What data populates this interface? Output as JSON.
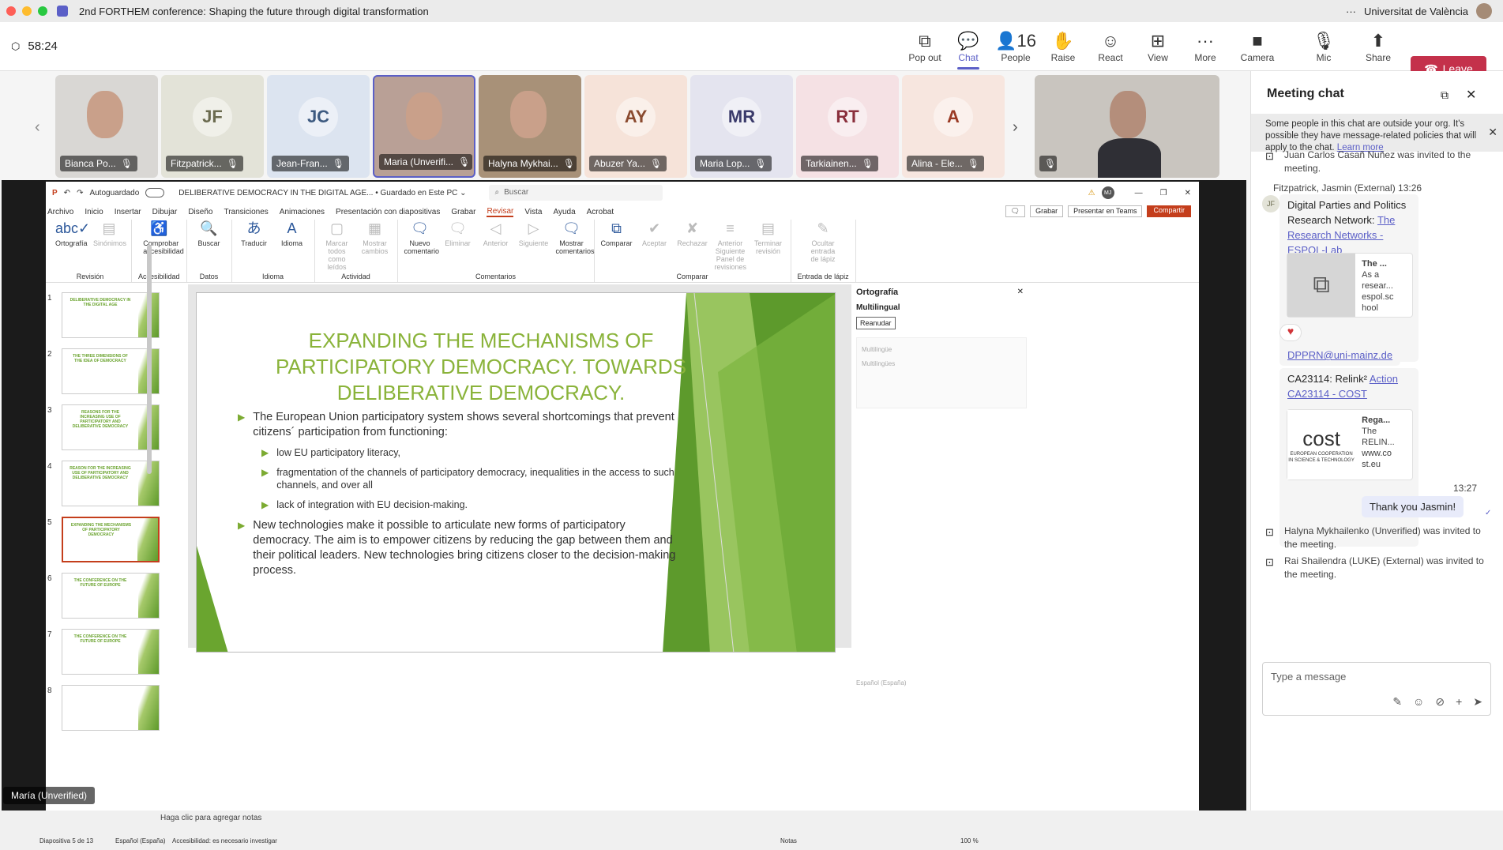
{
  "window": {
    "title": "2nd FORTHEM conference: Shaping the future through digital transformation",
    "org": "Universitat de València",
    "more": "···"
  },
  "meeting": {
    "timer": "58:24",
    "buttons": [
      {
        "label": "Pop out",
        "icon": "popout-icon",
        "glyph": "⧉"
      },
      {
        "label": "Chat",
        "icon": "chat-icon",
        "glyph": "💬"
      },
      {
        "label": "People",
        "icon": "people-icon",
        "glyph": "👤16"
      },
      {
        "label": "Raise",
        "icon": "hand-icon",
        "glyph": "✋"
      },
      {
        "label": "React",
        "icon": "smile-icon",
        "glyph": "☺"
      },
      {
        "label": "View",
        "icon": "grid-icon",
        "glyph": "⊞"
      },
      {
        "label": "More",
        "icon": "more-icon",
        "glyph": "···"
      },
      {
        "label": "Camera",
        "icon": "camera-icon",
        "glyph": "■"
      },
      {
        "label": "Mic",
        "icon": "mic-off-icon",
        "glyph": "🎙"
      },
      {
        "label": "Share",
        "icon": "share-icon",
        "glyph": "⬆"
      }
    ],
    "leave": "Leave"
  },
  "participants": [
    {
      "name": "Bianca Po...",
      "initials": "",
      "bg": "#d9d7d4",
      "photo": true
    },
    {
      "name": "Fitzpatrick...",
      "initials": "JF",
      "bg": "#e3e3d8",
      "fg": "#6b6b4f"
    },
    {
      "name": "Jean-Fran...",
      "initials": "JC",
      "bg": "#dce4f0",
      "fg": "#3d5a80"
    },
    {
      "name": "Maria (Unverifi...",
      "initials": "",
      "bg": "#b9a096",
      "photo": true
    },
    {
      "name": "Halyna Mykhai...",
      "initials": "",
      "bg": "#a89178",
      "photo": true
    },
    {
      "name": "Abuzer Ya...",
      "initials": "AY",
      "bg": "#f6e3d9",
      "fg": "#8a4a2f"
    },
    {
      "name": "Maria Lop...",
      "initials": "MR",
      "bg": "#e4e4ef",
      "fg": "#3b3b6b"
    },
    {
      "name": "Tarkiainen...",
      "initials": "RT",
      "bg": "#f5e1e4",
      "fg": "#8a2f3c"
    },
    {
      "name": "Alina - Ele...",
      "initials": "A",
      "bg": "#f7e6df",
      "fg": "#9a3a24"
    }
  ],
  "presenter": "María (Unverified)",
  "ppt": {
    "autosave": "Autoguardado",
    "doc": "DELIBERATIVE DEMOCRACY IN THE DIGITAL AGE... • Guardado en Este PC ⌄",
    "search": "Buscar",
    "user": "MJ",
    "menu": [
      "Archivo",
      "Inicio",
      "Insertar",
      "Dibujar",
      "Diseño",
      "Transiciones",
      "Animaciones",
      "Presentación con diapositivas",
      "Grabar",
      "Revisar",
      "Vista",
      "Ayuda",
      "Acrobat"
    ],
    "record": "Grabar",
    "present_teams": "Presentar en Teams",
    "share": "Compartir",
    "groups": [
      {
        "label": "Revisión",
        "items": [
          {
            "t": "Ortografía",
            "g": "abc✓",
            "d": false
          },
          {
            "t": "Sinónimos",
            "g": "▤",
            "d": true
          }
        ]
      },
      {
        "label": "Accesibilidad",
        "items": [
          {
            "t": "Comprobar accesibilidad",
            "g": "♿",
            "d": false
          }
        ]
      },
      {
        "label": "Datos",
        "items": [
          {
            "t": "Buscar",
            "g": "🔍",
            "d": false
          }
        ]
      },
      {
        "label": "Idioma",
        "items": [
          {
            "t": "Traducir",
            "g": "あ",
            "d": false
          },
          {
            "t": "Idioma",
            "g": "A",
            "d": false
          }
        ]
      },
      {
        "label": "Actividad",
        "items": [
          {
            "t": "Marcar todos como leídos",
            "g": "▢",
            "d": true
          },
          {
            "t": "Mostrar cambios",
            "g": "▦",
            "d": true
          }
        ]
      },
      {
        "label": "Comentarios",
        "items": [
          {
            "t": "Nuevo comentario",
            "g": "🗨",
            "d": false
          },
          {
            "t": "Eliminar",
            "g": "🗨",
            "d": true
          },
          {
            "t": "Anterior",
            "g": "◁",
            "d": true
          },
          {
            "t": "Siguiente",
            "g": "▷",
            "d": true
          },
          {
            "t": "Mostrar comentarios",
            "g": "🗨",
            "d": false
          }
        ]
      },
      {
        "label": "Comparar",
        "items": [
          {
            "t": "Comparar",
            "g": "⧉",
            "d": false
          },
          {
            "t": "Aceptar",
            "g": "✔",
            "d": true
          },
          {
            "t": "Rechazar",
            "g": "✘",
            "d": true
          },
          {
            "t": "Anterior Siguiente Panel de revisiones",
            "g": "≡",
            "d": true
          },
          {
            "t": "Terminar revisión",
            "g": "▤",
            "d": true
          }
        ]
      },
      {
        "label": "Entrada de lápiz",
        "items": [
          {
            "t": "Ocultar entrada de lápiz",
            "g": "✎",
            "d": true
          }
        ]
      }
    ],
    "thumbs": [
      {
        "n": "1",
        "t": "DELIBERATIVE DEMOCRACY IN THE DIGITAL AGE"
      },
      {
        "n": "2",
        "t": "THE THREE DIMENSIONS OF THE IDEA OF DEMOCRACY"
      },
      {
        "n": "3",
        "t": "REASONS FOR THE INCREASING USE OF PARTICIPATORY AND DELIBERATIVE DEMOCRACY"
      },
      {
        "n": "4",
        "t": "REASON FOR THE INCREASING USE OF PARTICIPATORY AND DELIBERATIVE DEMOCRACY"
      },
      {
        "n": "5",
        "t": "EXPANDING THE MECHANISMS OF PARTICIPATORY DEMOCRACY"
      },
      {
        "n": "6",
        "t": "THE CONFERENCE ON THE FUTURE OF EUROPE"
      },
      {
        "n": "7",
        "t": "THE CONFERENCE ON THE FUTURE OF EUROPE"
      },
      {
        "n": "8",
        "t": ""
      }
    ],
    "slide": {
      "title": "EXPANDING THE MECHANISMS OF PARTICIPATORY DEMOCRACY. TOWARDS DELIBERATIVE DEMOCRACY.",
      "b1": "The European Union participatory system shows several shortcomings that prevent citizens´ participation from functioning:",
      "s1": "low EU participatory literacy,",
      "s2": "fragmentation of the channels of participatory democracy, inequalities in the access to such channels, and over all",
      "s3": "lack of integration with EU decision-making.",
      "b2": "New technologies make it possible to articulate new forms of participatory democracy. The aim is to empower citizens by reducing the gap between them and their political leaders. New technologies bring citizens closer to the decision-making process."
    },
    "pane": {
      "title": "Ortografía",
      "word": "Multilingual",
      "resume": "Reanudar",
      "s1": "Multilingüe",
      "s2": "Multilingües",
      "lang": "Español (España)"
    },
    "notes": "Haga clic para agregar notas",
    "status": {
      "slide": "Diapositiva 5 de 13",
      "lang": "Español (España)",
      "acc": "Accesibilidad: es necesario investigar",
      "notes": "Notas",
      "zoom": "100 %"
    }
  },
  "chat": {
    "title": "Meeting chat",
    "banner": "Some people in this chat are outside your org. It's possible they have message-related policies that will apply to the chat.",
    "learn": "Learn more",
    "sys1": "Juan Carlos Casañ Nuñez was invited to the meeting.",
    "sender": "Fitzpatrick, Jasmin (External)  13:26",
    "m1a": "Digital Parties and Politics Research Network:",
    "m1b": "The Research Networks - ESPOL-Lab",
    "card1": {
      "t": "The ...",
      "d": "As a resear...",
      "u": "espol.sc hool"
    },
    "heart": "♥",
    "email": "DPPRN@uni-mainz.de",
    "m3a": "CA23114: Relink²",
    "m3b": "Action CA23114 - COST",
    "card2": {
      "t": "Rega...",
      "d": "The RELIN...",
      "u": "www.co st.eu",
      "logo": "cost",
      "sub": "EUROPEAN COOPERATION IN SCIENCE & TECHNOLOGY"
    },
    "time2": "13:27",
    "mine": "Thank you Jasmin!",
    "sys2": "Halyna Mykhailenko (Unverified) was invited to the meeting.",
    "sys3": "Rai Shailendra (LUKE) (External) was invited to the meeting.",
    "input": "Type a message"
  }
}
